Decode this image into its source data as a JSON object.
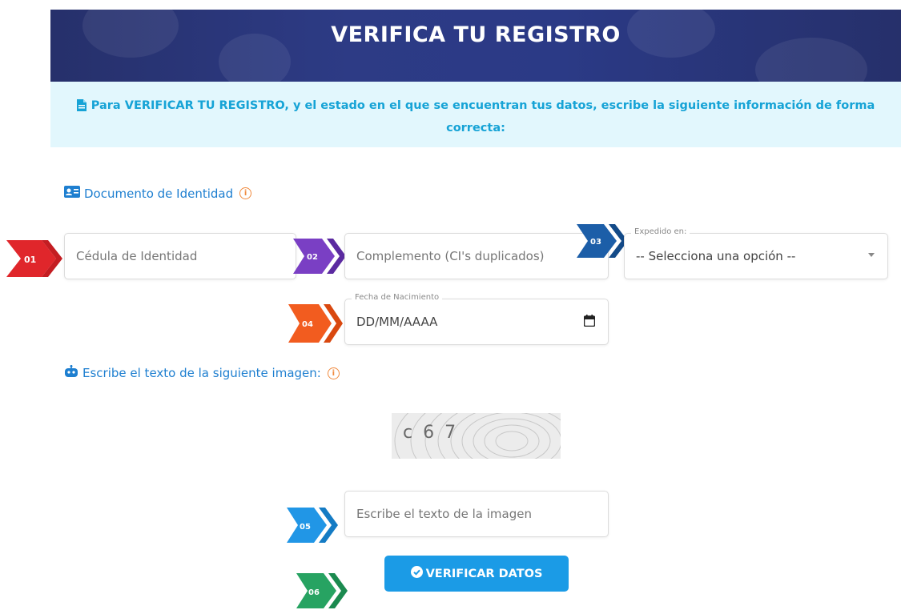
{
  "header": {
    "title": "VERIFICA TU REGISTRO"
  },
  "notice": {
    "text": "Para VERIFICAR TU REGISTRO, y el estado en el que se encuentran tus datos, escribe la siguiente información de forma correcta:",
    "icon": "file-icon"
  },
  "identity_section": {
    "title": "Documento de Identidad",
    "icon": "id-card-icon"
  },
  "fields": {
    "cedula": {
      "placeholder": "Cédula de Identidad"
    },
    "complemento": {
      "placeholder": "Complemento (CI's duplicados)"
    },
    "expedido": {
      "label": "Expedido en:",
      "selected": "-- Selecciona una opción --"
    },
    "fecha": {
      "label": "Fecha de Nacimiento",
      "value": "DD/MM/AAAA"
    },
    "captcha_input": {
      "placeholder": "Escribe el texto de la imagen"
    }
  },
  "captcha_section": {
    "title": "Escribe el texto de la siguiente imagen:",
    "icon": "robot-icon"
  },
  "captcha_image": {
    "text": "c 6 7"
  },
  "submit": {
    "label": "VERIFICAR DATOS",
    "icon": "check-circle-icon"
  },
  "step_badges": [
    "01",
    "02",
    "03",
    "04",
    "05",
    "06"
  ],
  "colors": {
    "banner": "#2b3a86",
    "notice_bg": "#e2f7fd",
    "notice_text": "#16a3d6",
    "section_title": "#1e7fd0",
    "button": "#1b9be6",
    "badge_01": "#e0262b",
    "badge_02": "#7a3fc4",
    "badge_03": "#1c5ea8",
    "badge_04": "#f25c1f",
    "badge_05": "#2196e6",
    "badge_06": "#27a362"
  }
}
